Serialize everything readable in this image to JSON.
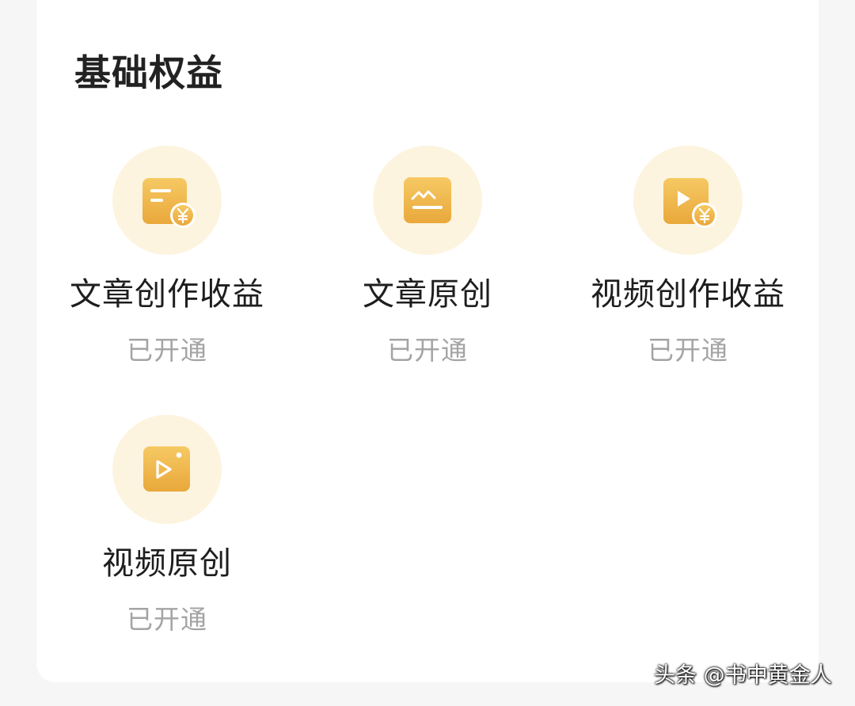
{
  "section": {
    "title": "基础权益"
  },
  "benefits": [
    {
      "name": "文章创作收益",
      "status": "已开通",
      "icon": "article-earnings-icon"
    },
    {
      "name": "文章原创",
      "status": "已开通",
      "icon": "article-original-icon"
    },
    {
      "name": "视频创作收益",
      "status": "已开通",
      "icon": "video-earnings-icon"
    },
    {
      "name": "视频原创",
      "status": "已开通",
      "icon": "video-original-icon"
    }
  ],
  "watermark": {
    "text": "头条 @书中黄金人"
  },
  "colors": {
    "icon_gradient_top": "#f6c963",
    "icon_gradient_bottom": "#e9a83b",
    "circle_bg": "#fdf4df",
    "status_gray": "#a4a4a4"
  }
}
